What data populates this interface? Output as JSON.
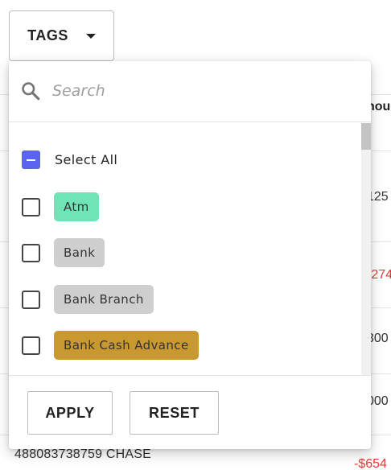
{
  "tags_button": {
    "label": "TAGS"
  },
  "search": {
    "placeholder": "Search",
    "value": ""
  },
  "select_all": {
    "label": "Select All",
    "state": "indeterminate"
  },
  "tags": [
    {
      "label": "Atm",
      "color": "#6fe5b7",
      "checked": false
    },
    {
      "label": "Bank",
      "color": "#cfcfcf",
      "checked": false
    },
    {
      "label": "Bank Branch",
      "color": "#cfcfcf",
      "checked": false
    },
    {
      "label": "Bank Cash Advance",
      "color": "#c9992f",
      "checked": false
    }
  ],
  "actions": {
    "apply_label": "APPLY",
    "reset_label": "RESET"
  },
  "background": {
    "column_header": "nou",
    "amounts": [
      "125",
      "-274",
      "300",
      "000",
      "-$654"
    ],
    "row_description": "488083738759 CHASE"
  },
  "colors": {
    "accent": "#5b63f0",
    "negative": "#e53935"
  }
}
